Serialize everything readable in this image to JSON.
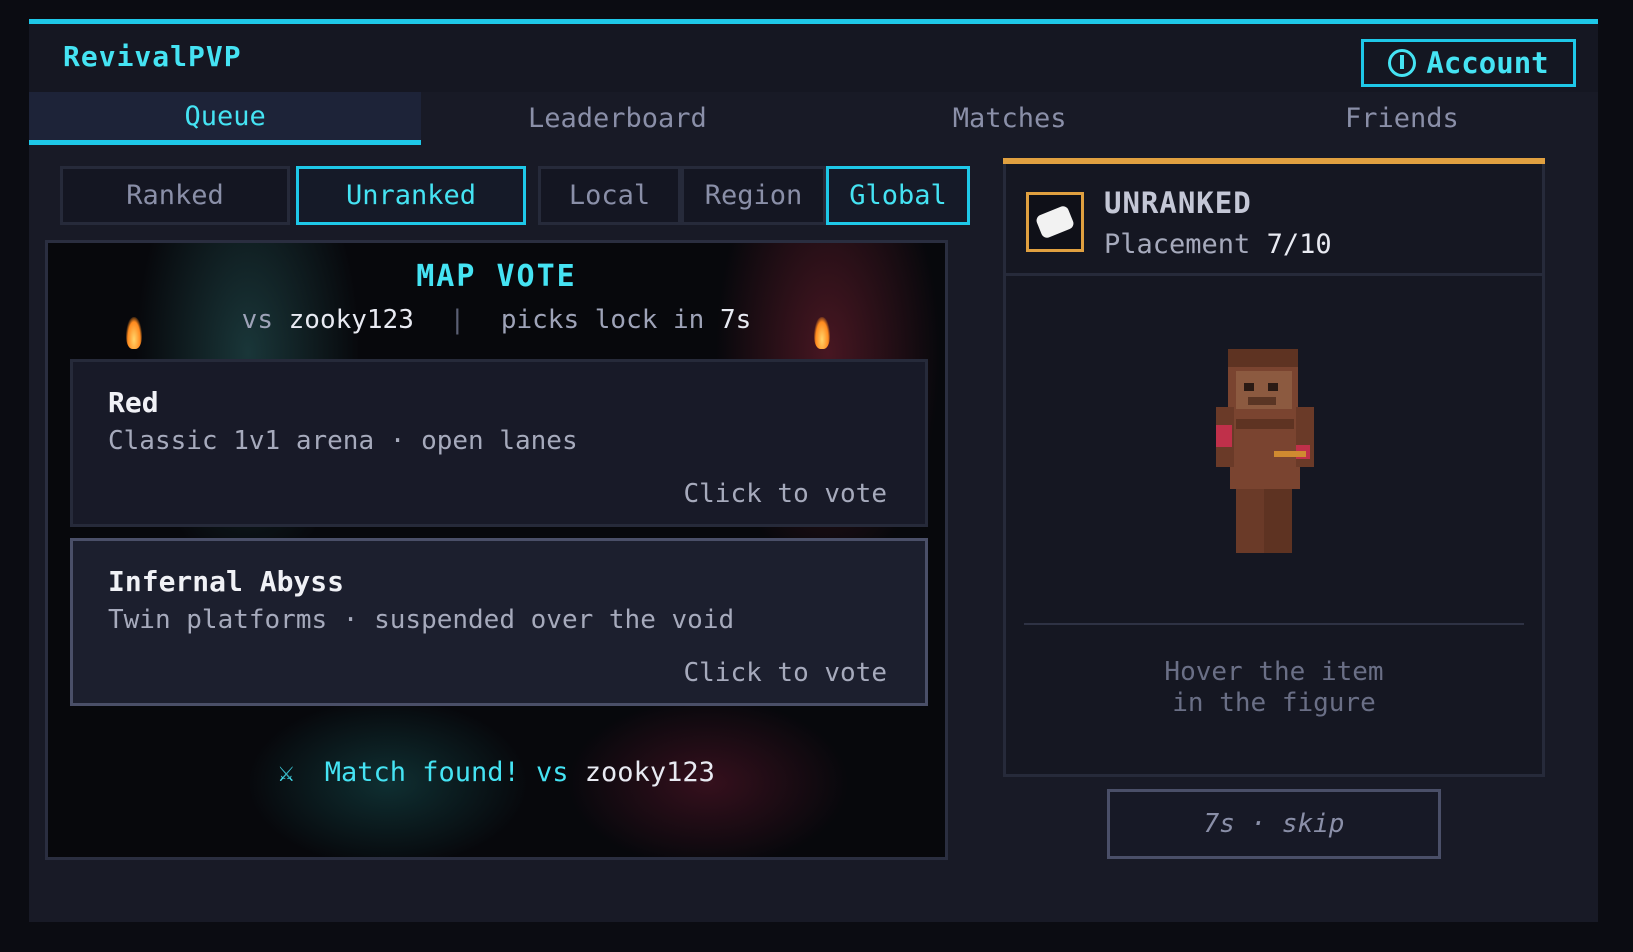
{
  "app": {
    "title": "RevivalPVP",
    "account_label": "Account",
    "account_icon": "power-icon"
  },
  "tabs": [
    {
      "label": "Queue",
      "active": true
    },
    {
      "label": "Leaderboard",
      "active": false
    },
    {
      "label": "Matches",
      "active": false
    },
    {
      "label": "Friends",
      "active": false
    }
  ],
  "mode_toggle": [
    {
      "label": "Ranked",
      "active": false
    },
    {
      "label": "Unranked",
      "active": true
    }
  ],
  "scope_toggle": [
    {
      "label": "Local",
      "active": false
    },
    {
      "label": "Region",
      "active": false
    },
    {
      "label": "Global",
      "active": true
    }
  ],
  "map_vote": {
    "title": "MAP VOTE",
    "vs_prefix": "vs",
    "opponent": "zooky123",
    "separator": "|",
    "lock_prefix": "picks lock in",
    "lock_time": "7s",
    "maps": [
      {
        "name": "Red",
        "description": "Classic 1v1 arena · open lanes",
        "cta": "Click to vote"
      },
      {
        "name": "Infernal Abyss",
        "description": "Twin platforms · suspended over the void",
        "cta": "Click to vote"
      }
    ],
    "match_found_text": "Match found! vs",
    "match_found_opponent": "zooky123",
    "match_icon": "swords-icon"
  },
  "rank_panel": {
    "title": "UNRANKED",
    "placement_label": "Placement",
    "placement_value": "7/10",
    "rank_icon": "scroll-icon",
    "hint_line1": "Hover the item",
    "hint_line2": "in the figure"
  },
  "skip_button": {
    "label": "7s · skip"
  },
  "colors": {
    "accent": "#1ec8e8",
    "gold": "#e0a040",
    "background": "#181a26"
  }
}
